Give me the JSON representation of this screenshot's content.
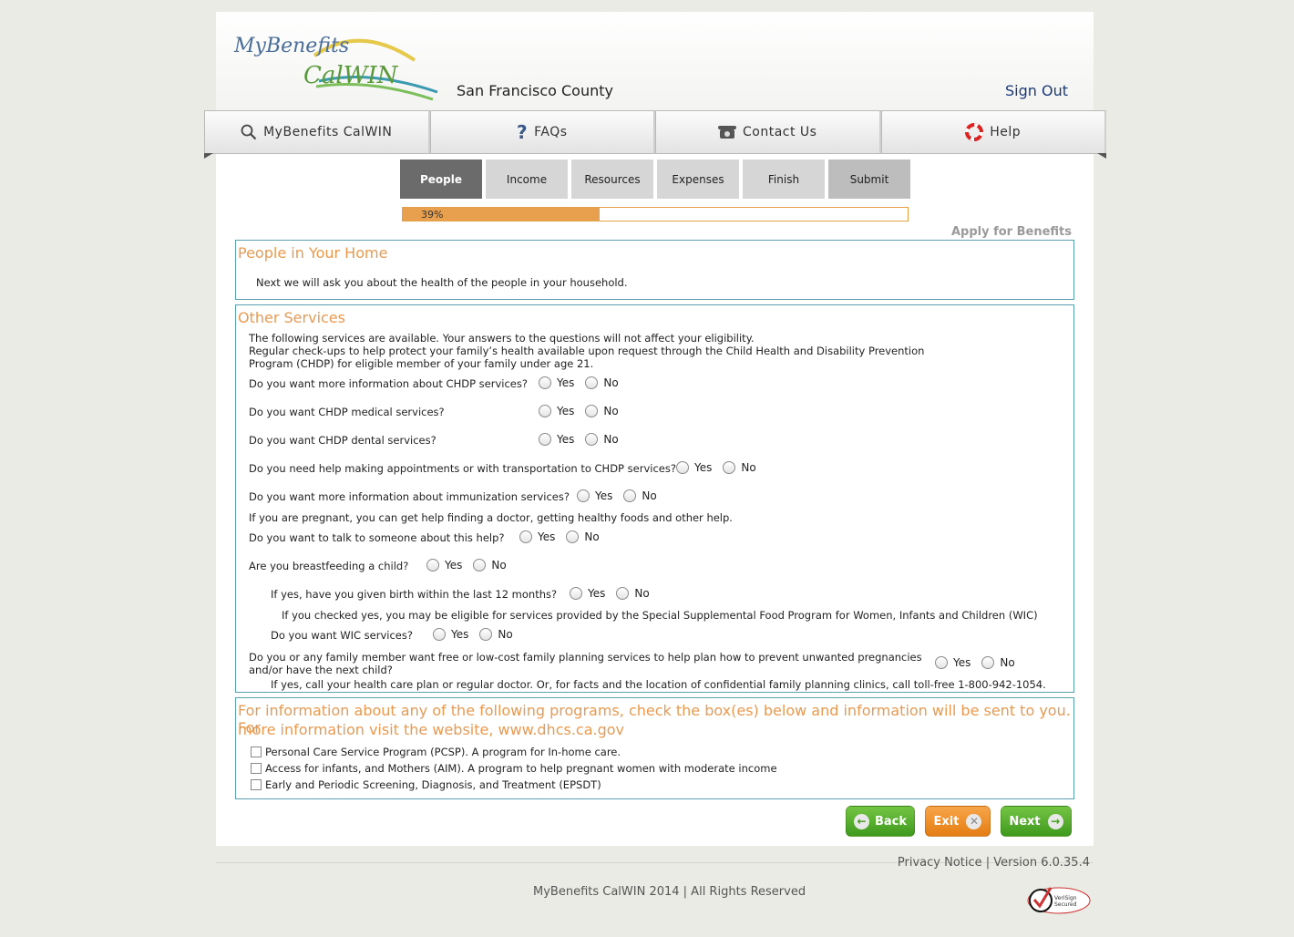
{
  "header": {
    "logo_text_top": "MyBenefits",
    "logo_text_bottom": "CalWIN",
    "county": "San Francisco County",
    "sign_out": "Sign Out"
  },
  "nav": [
    {
      "label": "MyBenefits CalWIN",
      "icon": "search-icon"
    },
    {
      "label": "FAQs",
      "icon": "question-icon"
    },
    {
      "label": "Contact Us",
      "icon": "phone-icon"
    },
    {
      "label": "Help",
      "icon": "lifebuoy-icon"
    }
  ],
  "steps": [
    "People",
    "Income",
    "Resources",
    "Expenses",
    "Finish",
    "Submit"
  ],
  "progress": {
    "percent": 39,
    "label": "39%"
  },
  "apply_label": "Apply for Benefits",
  "section1": {
    "title": "People in Your Home",
    "text": "Next we will ask you about the health of the people in your household."
  },
  "section2": {
    "title": "Other Services",
    "intro1": "The following services are available. Your answers to the questions will not affect your eligibility.",
    "intro2": "Regular check-ups to help protect your family’s health available upon request through the Child Health and Disability Prevention",
    "intro3": "Program (CHDP) for eligible member of your family under age 21.",
    "q1": "Do you want more information about CHDP services?",
    "q2": "Do you want CHDP medical services?",
    "q3": "Do you want CHDP dental services?",
    "q4": "Do you need help making appointments or with transportation to CHDP services?",
    "q5": "Do you want more information about immunization services?",
    "pregnant_note": "If you are pregnant, you can get help finding a doctor, getting healthy foods and other help.",
    "q6": "Do you want to talk to someone about this help?",
    "q7": "Are you breastfeeding a child?",
    "q8": "If yes, have you given birth within the last 12 months?",
    "wic_note": "If you checked yes, you may be eligible for services provided by the Special Supplemental Food Program for Women, Infants and Children (WIC)",
    "q9": "Do you want WIC services?",
    "q10a": "Do you or any family member want free or low-cost family planning services to help plan how to prevent unwanted pregnancies",
    "q10b": "and/or have the next child?",
    "fp_note": "If yes, call your health care plan or regular doctor. Or, for facts and the location of confidential family planning clinics, call toll-free 1-800-942-1054.",
    "yes": "Yes",
    "no": "No"
  },
  "section3": {
    "title1": "For information about any of the following programs, check the box(es) below and information will be sent to you. For",
    "title2": "more information visit the website, www.dhcs.ca.gov",
    "items": [
      "Personal Care Service Program (PCSP). A program for In-home care.",
      "Access for infants, and Mothers (AIM). A program to help pregnant women with moderate income",
      "Early and Periodic Screening, Diagnosis, and Treatment (EPSDT)"
    ]
  },
  "buttons": {
    "back": "Back",
    "exit": "Exit",
    "next": "Next"
  },
  "footer": {
    "privacy": "Privacy Notice",
    "sep": "|",
    "version": "Version  6.0.35.4",
    "copyright": "MyBenefits CalWIN 2014 | All Rights Reserved",
    "verisign": "VeriSign Secured"
  },
  "colors": {
    "accent": "#e99a50",
    "border": "#5aa0b0",
    "green": "#3f9a1d",
    "orange": "#e57d12"
  }
}
